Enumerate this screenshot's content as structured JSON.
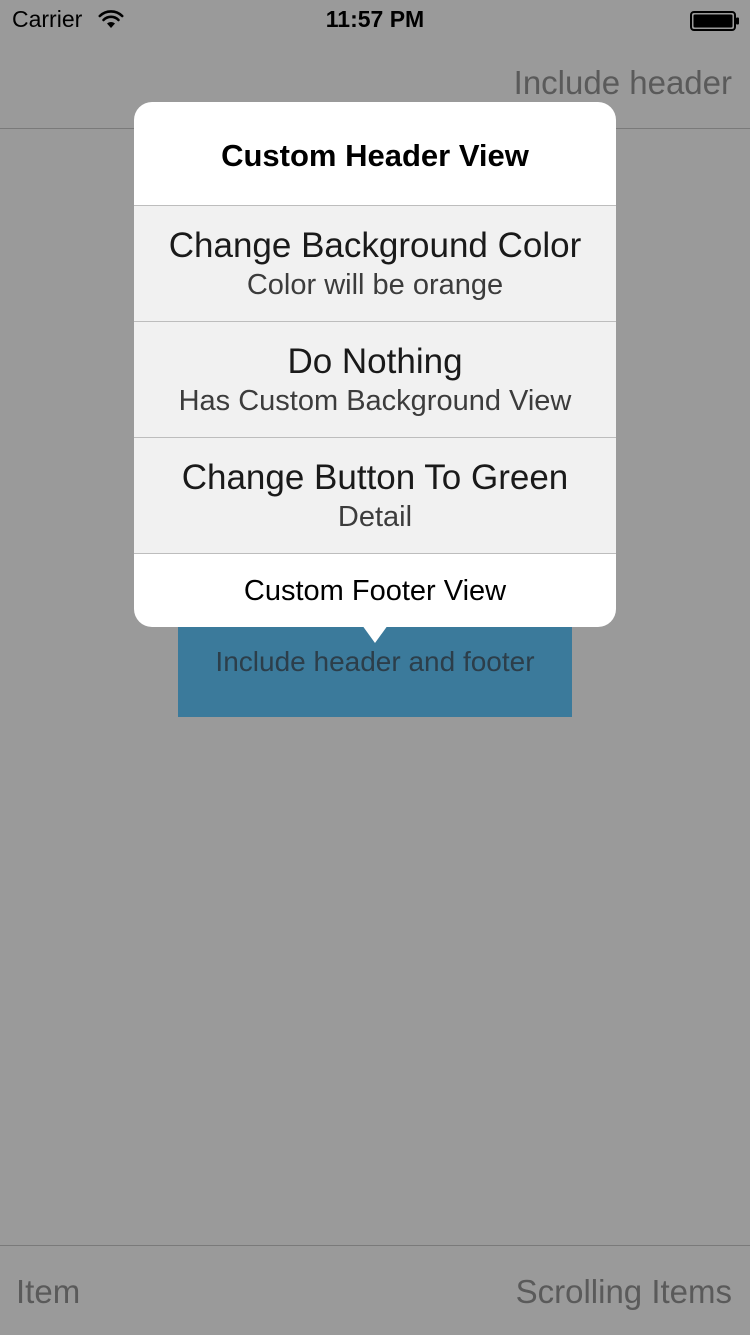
{
  "status_bar": {
    "carrier": "Carrier",
    "time": "11:57 PM",
    "wifi_icon": "wifi-icon",
    "battery_icon": "battery-icon"
  },
  "nav_bar": {
    "right_button": "Include header"
  },
  "main_button": {
    "label": "Include header and footer",
    "color": "#3b7a9b"
  },
  "popover": {
    "header": "Custom Header View",
    "rows": [
      {
        "title": "Change Background Color",
        "detail": "Color will be orange"
      },
      {
        "title": "Do Nothing",
        "detail": "Has Custom Background View"
      },
      {
        "title": "Change Button To Green",
        "detail": "Detail"
      }
    ],
    "footer": "Custom Footer View"
  },
  "toolbar": {
    "left_item": "Item",
    "right_item": "Scrolling Items"
  },
  "colors": {
    "dimmed_background": "#9a9a9a",
    "popover_background": "#ffffff",
    "row_background": "#f1f1f1"
  }
}
